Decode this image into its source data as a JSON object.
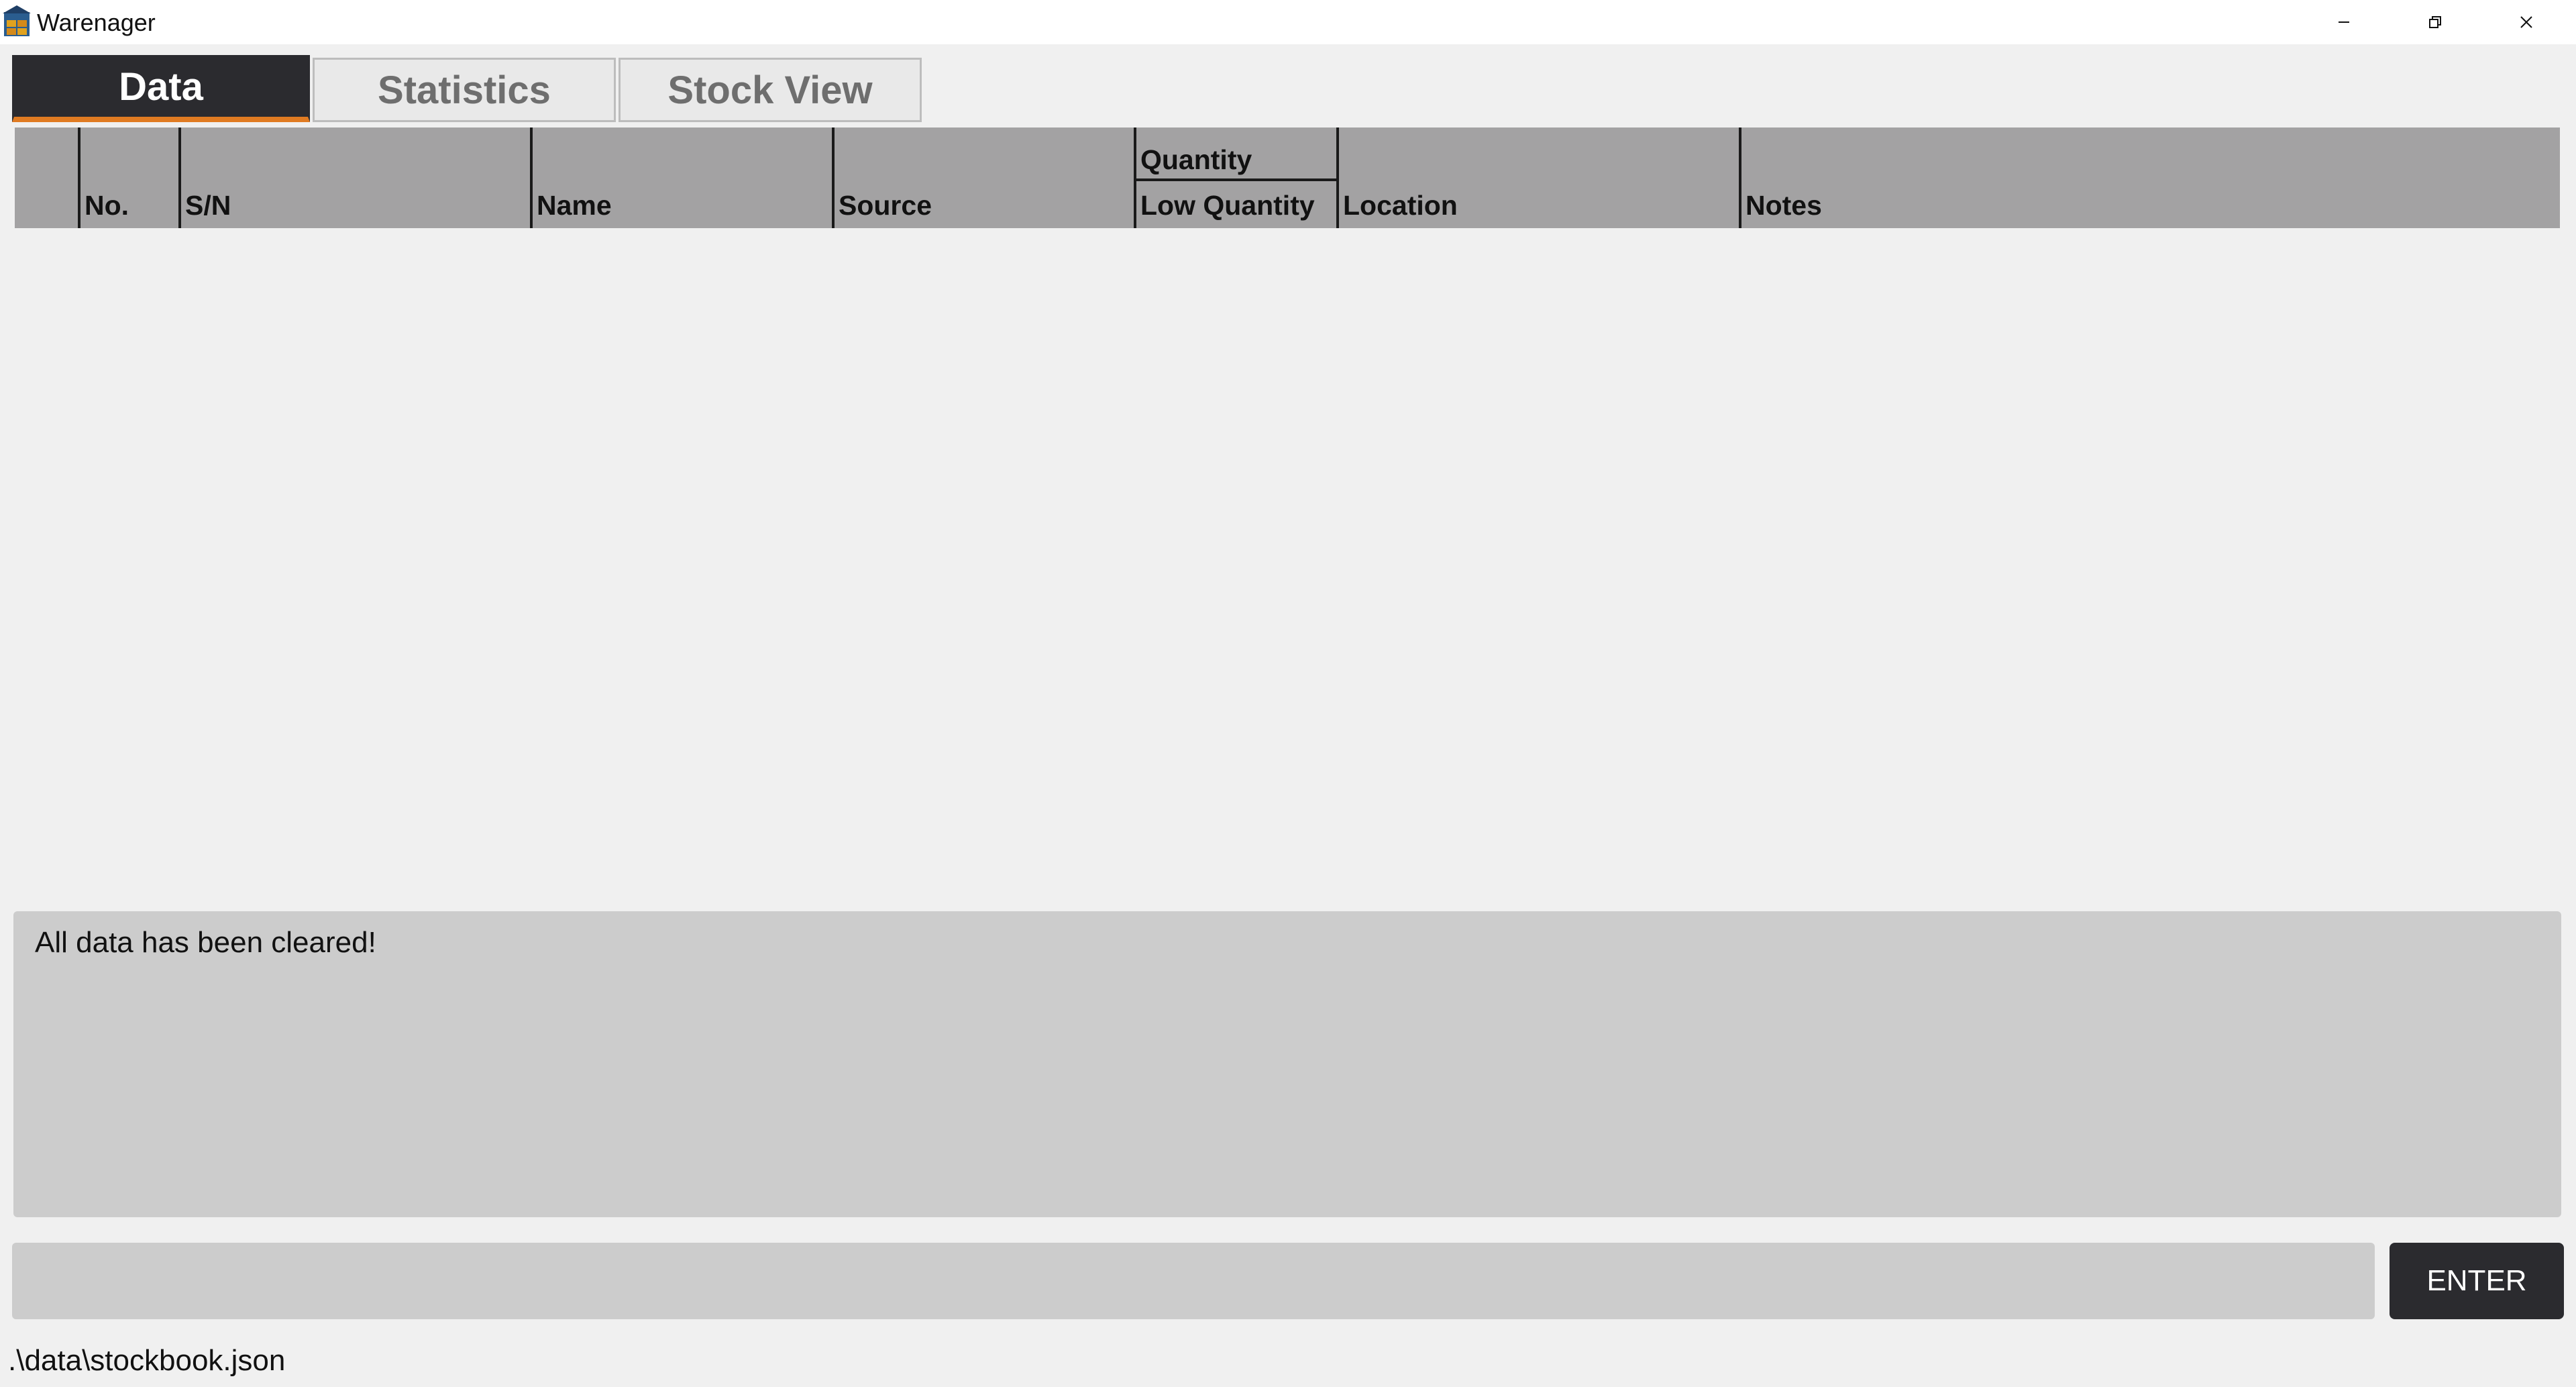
{
  "window": {
    "title": "Warenager",
    "icon": "warehouse-icon",
    "controls": [
      "minimize-icon",
      "restore-icon",
      "close-icon"
    ]
  },
  "tabs": [
    {
      "label": "Data",
      "active": true
    },
    {
      "label": "Statistics",
      "active": false
    },
    {
      "label": "Stock View",
      "active": false
    }
  ],
  "table": {
    "columns": {
      "index": "",
      "no": "No.",
      "sn": "S/N",
      "name": "Name",
      "source": "Source",
      "quantity": "Quantity",
      "low_quantity": "Low Quantity",
      "location": "Location",
      "notes": "Notes"
    },
    "rows": []
  },
  "result": {
    "message": "All data has been cleared!"
  },
  "command": {
    "value": "",
    "placeholder": "",
    "enter_label": "ENTER"
  },
  "status": {
    "file_path": ".\\data\\stockbook.json"
  },
  "colors": {
    "accent": "#e07b22",
    "dark": "#2b2b2f",
    "header_bg": "#a3a2a3",
    "panel_bg": "#cccccc"
  }
}
